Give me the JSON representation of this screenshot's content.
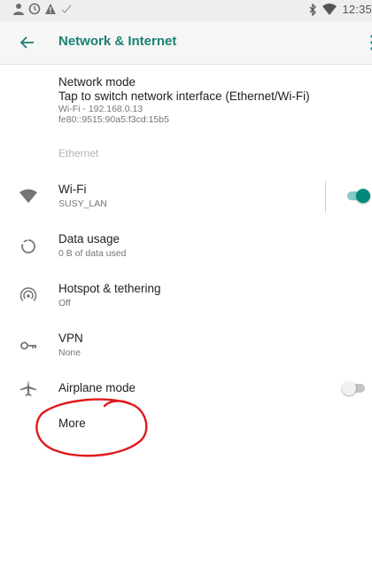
{
  "status_bar": {
    "time": "12:35",
    "left_icons": [
      "person-icon",
      "clock-icon",
      "warning-icon",
      "check-icon"
    ],
    "right_icons": [
      "bluetooth-icon",
      "wifi-icon"
    ]
  },
  "toolbar": {
    "title": "Network & Internet",
    "back_icon": "arrow-left-icon"
  },
  "network_mode": {
    "title": "Network mode",
    "subtitle": "Tap to switch network interface (Ethernet/Wi-Fi)",
    "detail1": "Wi-Fi - 192.168.0.13",
    "detail2": "fe80::9515:90a5:f3cd:15b5"
  },
  "ethernet_label": "Ethernet",
  "items": [
    {
      "title": "Wi-Fi",
      "summary": "SUSY_LAN",
      "icon": "wifi-icon",
      "toggle": true
    },
    {
      "title": "Data usage",
      "summary": "0 B of data used",
      "icon": "data-usage-icon"
    },
    {
      "title": "Hotspot & tethering",
      "summary": "Off",
      "icon": "hotspot-icon"
    },
    {
      "title": "VPN",
      "summary": "None",
      "icon": "vpn-key-icon"
    },
    {
      "title": "Airplane mode",
      "summary": "",
      "icon": "airplane-icon",
      "toggle": false
    },
    {
      "title": "More",
      "summary": "",
      "icon": ""
    }
  ],
  "colors": {
    "accent": "#1a8073",
    "toggle_on_thumb": "#00897b",
    "toggle_on_track": "#80cbc4",
    "toggle_off_thumb": "#f1f1f1",
    "toggle_off_track": "#c4c4c4",
    "annotation": "#e0191b"
  }
}
